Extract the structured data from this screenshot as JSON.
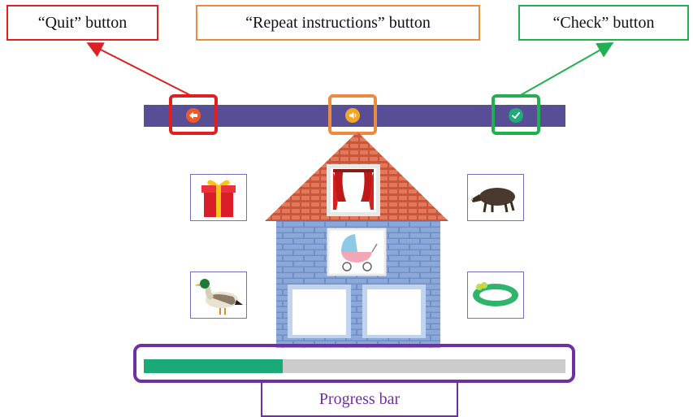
{
  "callouts": {
    "quit": "“Quit” button",
    "repeat": "“Repeat instructions” button",
    "check": "“Check” button",
    "progress": "Progress bar"
  },
  "toolbar": {
    "quit_icon": "arrow-left-icon",
    "repeat_icon": "speaker-icon",
    "check_icon": "checkmark-icon"
  },
  "cards": [
    {
      "name": "gift",
      "icon": "gift-box-icon"
    },
    {
      "name": "boar",
      "icon": "boar-icon"
    },
    {
      "name": "duck",
      "icon": "duck-icon"
    },
    {
      "name": "ring",
      "icon": "ring-icon"
    }
  ],
  "house": {
    "window_image": "curtains-icon",
    "center_image": "baby-stroller-icon",
    "slots": 2
  },
  "progress": {
    "value": 0.33
  },
  "colors": {
    "toolbar": "#574e96",
    "quit": "#e02020",
    "repeat": "#ee8a3c",
    "check": "#20b050",
    "progress_frame": "#7030a0",
    "progress_fill": "#1aaa78",
    "progress_track": "#cccccc"
  }
}
